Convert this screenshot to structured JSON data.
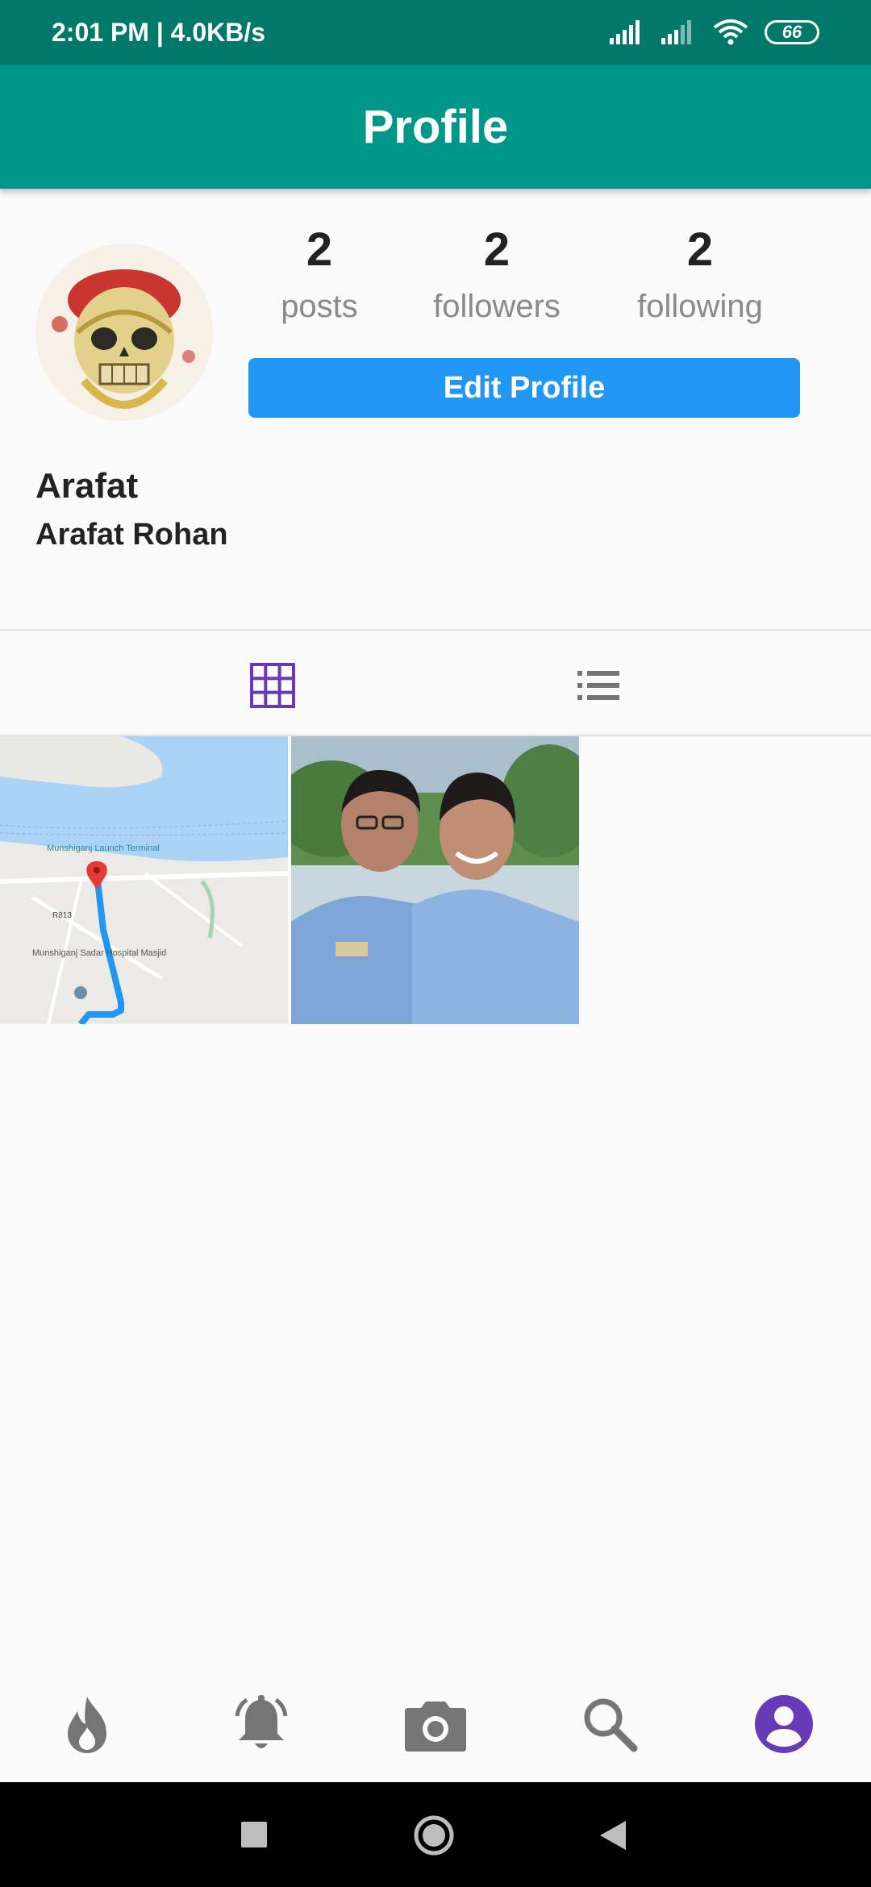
{
  "status_bar": {
    "time_speed": "2:01 PM | 4.0KB/s",
    "battery": "66"
  },
  "app_bar": {
    "title": "Profile"
  },
  "profile": {
    "stats": [
      {
        "value": "2",
        "label": "posts"
      },
      {
        "value": "2",
        "label": "followers"
      },
      {
        "value": "2",
        "label": "following"
      }
    ],
    "edit_button": "Edit Profile",
    "username": "Arafat",
    "full_name": "Arafat Rohan"
  },
  "map_labels": {
    "terminal": "Munshiganj Launch Terminal",
    "masjid": "Munshiganj Sadar Hospital Masjid",
    "road": "R813"
  },
  "colors": {
    "status_bar": "#00796b",
    "app_bar": "#009688",
    "button": "#2196f3",
    "accent": "#673ab7"
  },
  "icons": {
    "tab_grid": "grid-icon",
    "tab_list": "list-icon",
    "nav": [
      "fire-icon",
      "bell-icon",
      "camera-icon",
      "search-icon",
      "account-icon"
    ],
    "system": [
      "recents-square-icon",
      "home-circle-icon",
      "back-triangle-icon"
    ]
  }
}
